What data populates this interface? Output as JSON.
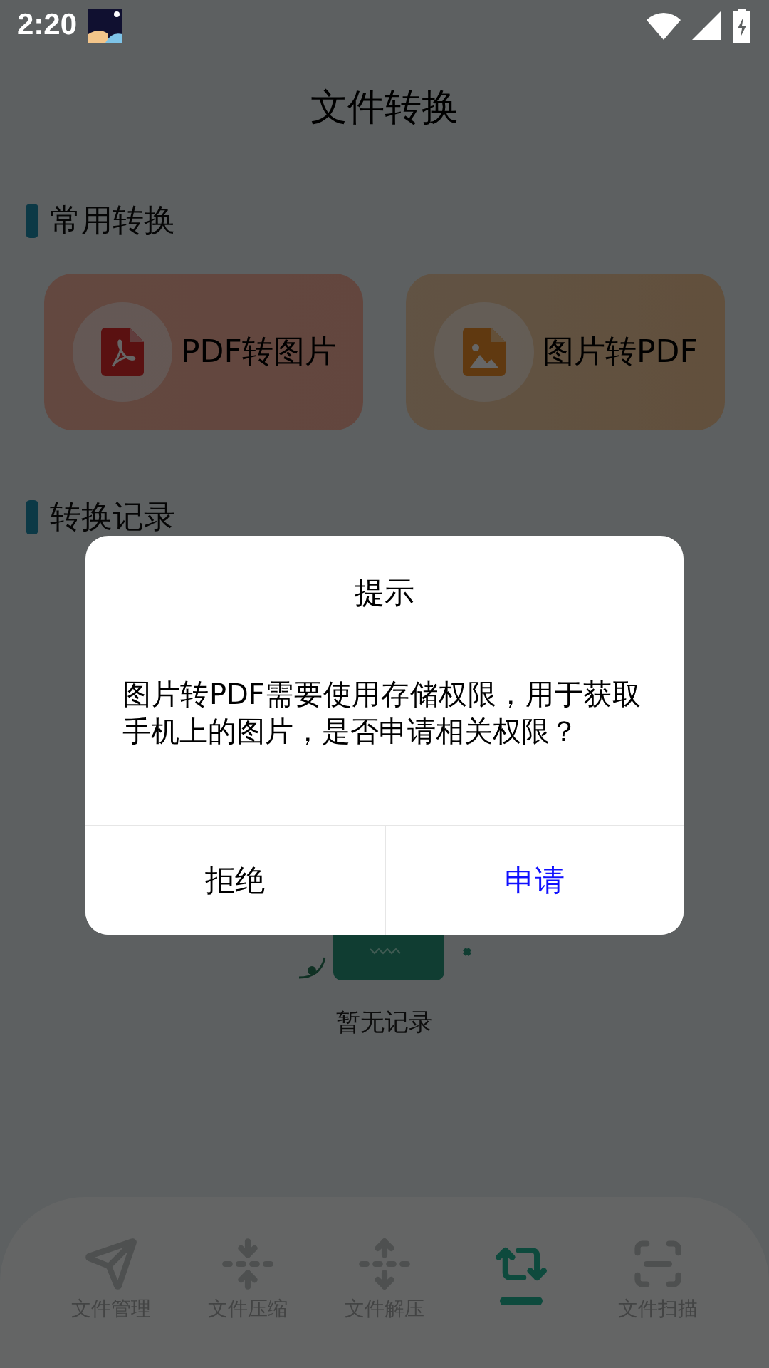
{
  "status_bar": {
    "time": "2:20"
  },
  "title": "文件转换",
  "common": {
    "heading": "常用转换",
    "cards": [
      {
        "label": "PDF转图片",
        "kind": "pdf"
      },
      {
        "label": "图片转PDF",
        "kind": "image"
      }
    ]
  },
  "records": {
    "heading": "转换记录",
    "empty_text": "暂无记录"
  },
  "dialog": {
    "title": "提示",
    "message": "图片转PDF需要使用存储权限，用于获取手机上的图片，是否申请相关权限？",
    "buttons": [
      {
        "label": "拒绝",
        "kind": "cancel"
      },
      {
        "label": "申请",
        "kind": "confirm"
      }
    ]
  },
  "nav": [
    {
      "label": "文件管理",
      "kind": "send",
      "selected": false
    },
    {
      "label": "文件压缩",
      "kind": "compress",
      "selected": false
    },
    {
      "label": "文件解压",
      "kind": "decompress",
      "selected": false
    },
    {
      "kind": "convert",
      "selected": true
    },
    {
      "label": "文件扫描",
      "kind": "scan",
      "selected": false
    }
  ]
}
